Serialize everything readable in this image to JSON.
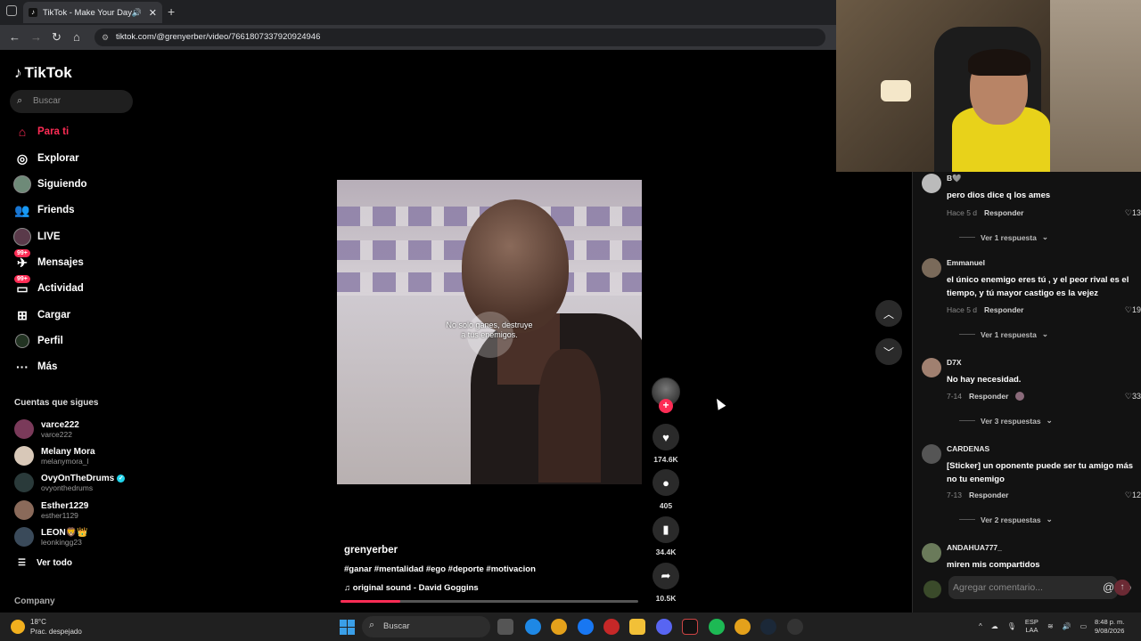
{
  "browser": {
    "tab_title": "TikTok - Make Your Day",
    "url": "tiktok.com/@grenyerber/video/7661807337920924946"
  },
  "sidebar": {
    "logo": "TikTok",
    "search_placeholder": "Buscar",
    "nav": [
      {
        "label": "Para ti",
        "icon": "home-icon"
      },
      {
        "label": "Explorar",
        "icon": "compass-icon"
      },
      {
        "label": "Siguiendo",
        "icon": "avatar-icon"
      },
      {
        "label": "Friends",
        "icon": "friends-icon"
      },
      {
        "label": "LIVE",
        "icon": "live-icon"
      },
      {
        "label": "Mensajes",
        "icon": "messages-icon",
        "badge": "99+"
      },
      {
        "label": "Actividad",
        "icon": "activity-icon",
        "badge": "99+"
      },
      {
        "label": "Cargar",
        "icon": "upload-icon"
      },
      {
        "label": "Perfil",
        "icon": "profile-icon"
      },
      {
        "label": "Más",
        "icon": "more-icon"
      }
    ],
    "following_title": "Cuentas que sigues",
    "accounts": [
      {
        "name": "varce222",
        "handle": "varce222"
      },
      {
        "name": "Melany Mora",
        "handle": "melanymora_l"
      },
      {
        "name": "OvyOnTheDrums",
        "handle": "ovyonthedrums",
        "verified": true
      },
      {
        "name": "Esther1229",
        "handle": "esther1129"
      },
      {
        "name": "LEON🦁👑",
        "handle": "leonkingg23"
      }
    ],
    "see_all": "Ver todo",
    "company": "Company"
  },
  "video": {
    "subtitle_line1": "No solo ganes, destruye",
    "subtitle_line2": "a tus enemigos.",
    "progress": 0.2,
    "author": "grenyerber",
    "hashtags": "#ganar #mentalidad #ego #deporte #motivacion",
    "sound": "original sound - David Goggins"
  },
  "actions": {
    "likes": "174.6K",
    "comments": "405",
    "saves": "34.4K",
    "shares": "10.5K"
  },
  "comments": [
    {
      "user": "B🩶",
      "text": "pero dios dice q los ames",
      "time": "Hace 5 d",
      "reply": "Responder",
      "likes": "13",
      "replies": "Ver 1 respuesta"
    },
    {
      "user": "Emmanuel",
      "text": "el único enemigo eres tú , y el peor rival es el tiempo, y tú mayor castigo es la vejez",
      "time": "Hace 5 d",
      "reply": "Responder",
      "likes": "19",
      "replies": "Ver 1 respuesta"
    },
    {
      "user": "D7X",
      "text": "No hay necesidad.",
      "time": "7-14",
      "reply": "Responder",
      "likes": "33",
      "replies": "Ver 3 respuestas"
    },
    {
      "user": "CARDENAS",
      "text": "[Sticker] un oponente puede ser tu amigo más no tu enemigo",
      "time": "7-13",
      "reply": "Responder",
      "likes": "12",
      "replies": "Ver 2 respuestas"
    },
    {
      "user": "ANDAHUA777_",
      "text": "miren mis compartidos"
    }
  ],
  "comment_input": {
    "placeholder": "Agregar comentario..."
  },
  "taskbar": {
    "temp": "18°C",
    "weather": "Prac. despejado",
    "search": "Buscar",
    "lang1": "ESP",
    "lang2": "LAA",
    "time": "8:48 p. m.",
    "date": "9/08/2026"
  }
}
